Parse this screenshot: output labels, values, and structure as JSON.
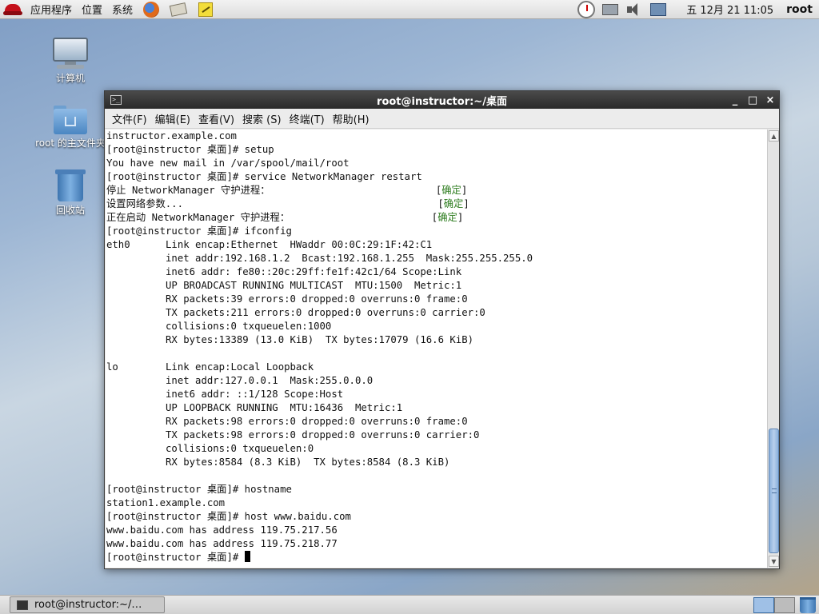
{
  "top_panel": {
    "menus": [
      "应用程序",
      "位置",
      "系统"
    ],
    "clock": "五 12月 21 11:05",
    "user": "root",
    "launchers": [
      "firefox-icon",
      "mail-icon",
      "note-icon"
    ],
    "tray_icons": [
      "clock-applet-icon",
      "network-icon",
      "volume-icon",
      "network-manager-icon"
    ]
  },
  "desktop": {
    "icons": [
      {
        "label": "计算机",
        "icon": "computer-icon"
      },
      {
        "label": "root 的主文件夹",
        "icon": "home-folder-icon"
      },
      {
        "label": "回收站",
        "icon": "trash-icon"
      }
    ]
  },
  "window": {
    "title": "root@instructor:~/桌面",
    "menu": [
      "文件(F)",
      "编辑(E)",
      "查看(V)",
      "搜索 (S)",
      "终端(T)",
      "帮助(H)"
    ],
    "controls": {
      "minimize": "_",
      "maximize": "□",
      "close": "×"
    }
  },
  "terminal": {
    "ok_label": "确定",
    "lines": [
      "instructor.example.com",
      "[root@instructor 桌面]# setup",
      "You have new mail in /var/spool/mail/root",
      "[root@instructor 桌面]# service NetworkManager restart",
      "停止 NetworkManager 守护进程：                            [",
      "设置网络参数...                                           [",
      "正在启动 NetworkManager 守护进程：                        [",
      "[root@instructor 桌面]# ifconfig",
      "eth0      Link encap:Ethernet  HWaddr 00:0C:29:1F:42:C1",
      "          inet addr:192.168.1.2  Bcast:192.168.1.255  Mask:255.255.255.0",
      "          inet6 addr: fe80::20c:29ff:fe1f:42c1/64 Scope:Link",
      "          UP BROADCAST RUNNING MULTICAST  MTU:1500  Metric:1",
      "          RX packets:39 errors:0 dropped:0 overruns:0 frame:0",
      "          TX packets:211 errors:0 dropped:0 overruns:0 carrier:0",
      "          collisions:0 txqueuelen:1000",
      "          RX bytes:13389 (13.0 KiB)  TX bytes:17079 (16.6 KiB)",
      "",
      "lo        Link encap:Local Loopback",
      "          inet addr:127.0.0.1  Mask:255.0.0.0",
      "          inet6 addr: ::1/128 Scope:Host",
      "          UP LOOPBACK RUNNING  MTU:16436  Metric:1",
      "          RX packets:98 errors:0 dropped:0 overruns:0 frame:0",
      "          TX packets:98 errors:0 dropped:0 overruns:0 carrier:0",
      "          collisions:0 txqueuelen:0",
      "          RX bytes:8584 (8.3 KiB)  TX bytes:8584 (8.3 KiB)",
      "",
      "[root@instructor 桌面]# hostname",
      "station1.example.com",
      "[root@instructor 桌面]# host www.baidu.com",
      "www.baidu.com has address 119.75.217.56",
      "www.baidu.com has address 119.75.218.77",
      "[root@instructor 桌面]# "
    ],
    "ok_line_indices": [
      4,
      5,
      6
    ],
    "cursor_line_index": 31
  },
  "taskbar": {
    "task_label": "root@instructor:~/…",
    "active_workspace": 1
  },
  "colors": {
    "ok_text": "#2e7d1f",
    "titlebar": "#2a2a2a"
  }
}
